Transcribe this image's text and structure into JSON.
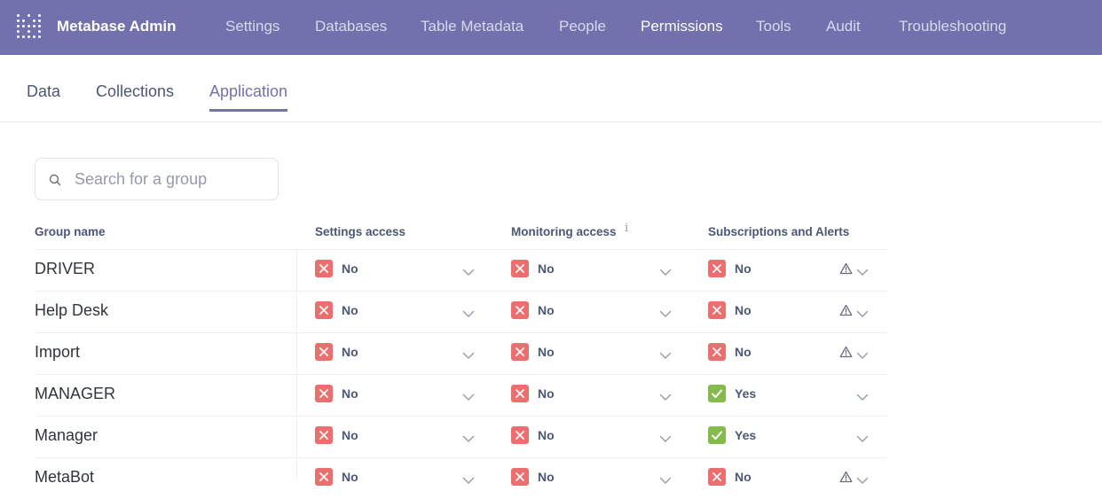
{
  "app": {
    "title": "Metabase Admin"
  },
  "nav": {
    "items": [
      {
        "label": "Settings",
        "active": false
      },
      {
        "label": "Databases",
        "active": false
      },
      {
        "label": "Table Metadata",
        "active": false
      },
      {
        "label": "People",
        "active": false
      },
      {
        "label": "Permissions",
        "active": true
      },
      {
        "label": "Tools",
        "active": false
      },
      {
        "label": "Audit",
        "active": false
      },
      {
        "label": "Troubleshooting",
        "active": false
      }
    ]
  },
  "tabs": [
    {
      "label": "Data",
      "active": false
    },
    {
      "label": "Collections",
      "active": false
    },
    {
      "label": "Application",
      "active": true
    }
  ],
  "search": {
    "placeholder": "Search for a group",
    "value": ""
  },
  "table": {
    "columns": [
      "Group name",
      "Settings access",
      "Monitoring access",
      "Subscriptions and Alerts"
    ],
    "monitoring_info_icon": "info-icon",
    "rows": [
      {
        "name": "DRIVER",
        "settings": "No",
        "monitoring": "No",
        "subscriptions": "No",
        "warning": true
      },
      {
        "name": "Help Desk",
        "settings": "No",
        "monitoring": "No",
        "subscriptions": "No",
        "warning": true
      },
      {
        "name": "Import",
        "settings": "No",
        "monitoring": "No",
        "subscriptions": "No",
        "warning": true
      },
      {
        "name": "MANAGER",
        "settings": "No",
        "monitoring": "No",
        "subscriptions": "Yes",
        "warning": false
      },
      {
        "name": "Manager",
        "settings": "No",
        "monitoring": "No",
        "subscriptions": "Yes",
        "warning": false
      },
      {
        "name": "MetaBot",
        "settings": "No",
        "monitoring": "No",
        "subscriptions": "No",
        "warning": true
      }
    ]
  },
  "colors": {
    "nav_bg": "#7172ad",
    "accent": "#7172ad",
    "no_badge": "#ed6e6e",
    "yes_badge": "#84bb4c"
  }
}
